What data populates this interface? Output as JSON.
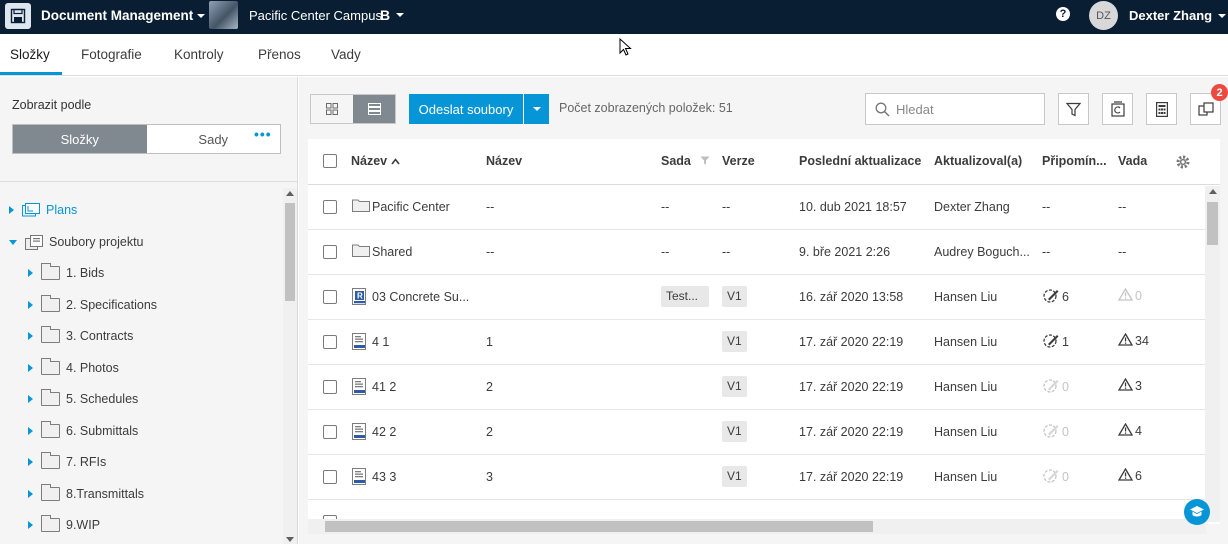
{
  "header": {
    "app_title": "Document Management",
    "project_name": "Pacific Center Campus",
    "project_badge": "B",
    "help": "?",
    "user_initials": "DZ",
    "user_name": "Dexter Zhang"
  },
  "tabs": [
    {
      "label": "Složky",
      "active": true
    },
    {
      "label": "Fotografie",
      "active": false
    },
    {
      "label": "Kontroly",
      "active": false
    },
    {
      "label": "Přenos",
      "active": false
    },
    {
      "label": "Vady",
      "active": false
    }
  ],
  "sidebar": {
    "view_by_label": "Zobrazit podle",
    "toggle": {
      "folders": "Složky",
      "sets": "Sady",
      "selected": "folders"
    },
    "more_label": "•••",
    "tree": [
      {
        "label": "Plans",
        "expanded": false,
        "highlight": true,
        "icon": "plans-icon"
      },
      {
        "label": "Soubory projektu",
        "expanded": true,
        "icon": "project-files-icon"
      },
      {
        "label": "1. Bids",
        "expanded": false,
        "icon": "folder-icon"
      },
      {
        "label": "2. Specifications",
        "expanded": false,
        "icon": "folder-icon"
      },
      {
        "label": "3. Contracts",
        "expanded": false,
        "icon": "folder-icon"
      },
      {
        "label": "4. Photos",
        "expanded": false,
        "icon": "folder-icon"
      },
      {
        "label": "5. Schedules",
        "expanded": false,
        "icon": "folder-icon"
      },
      {
        "label": "6. Submittals",
        "expanded": false,
        "icon": "folder-icon"
      },
      {
        "label": "7. RFIs",
        "expanded": false,
        "icon": "folder-icon"
      },
      {
        "label": "8.Transmittals",
        "expanded": false,
        "icon": "folder-icon"
      },
      {
        "label": "9.WIP",
        "expanded": false,
        "icon": "folder-icon"
      }
    ]
  },
  "toolbar": {
    "upload_label": "Odeslat soubory",
    "count_text": "Počet zobrazených položek: 51",
    "search_placeholder": "Hledat",
    "badge_count": "2"
  },
  "table": {
    "columns": {
      "name": "Název",
      "title": "Název",
      "set": "Sada",
      "version": "Verze",
      "last_updated": "Poslední aktualizace",
      "updated_by": "Aktualizoval(a)",
      "markups": "Připomín...",
      "issues": "Vada"
    },
    "rows": [
      {
        "type": "folder",
        "name": "Pacific Center",
        "title": "--",
        "set": "--",
        "version": "--",
        "updated": "10. dub 2021 18:57",
        "by": "Dexter Zhang",
        "markups": "--",
        "issues": "--"
      },
      {
        "type": "folder",
        "name": "Shared",
        "title": "--",
        "set": "--",
        "version": "--",
        "updated": "9. bře 2021 2:26",
        "by": "Audrey Boguch...",
        "markups": "--",
        "issues": "--"
      },
      {
        "type": "revit",
        "name": "03 Concrete Su...",
        "title": "",
        "set": "Test...",
        "version": "V1",
        "updated": "16. zář 2020 13:58",
        "by": "Hansen Liu",
        "markups": "6",
        "markups_active": true,
        "issues": "0",
        "issues_active": false
      },
      {
        "type": "sheet",
        "name": "4 1",
        "title": "1",
        "set": "",
        "version": "V1",
        "updated": "17. zář 2020 22:19",
        "by": "Hansen Liu",
        "markups": "1",
        "markups_active": true,
        "issues": "34",
        "issues_active": true
      },
      {
        "type": "sheet",
        "name": "41 2",
        "title": "2",
        "set": "",
        "version": "V1",
        "updated": "17. zář 2020 22:19",
        "by": "Hansen Liu",
        "markups": "0",
        "markups_active": false,
        "issues": "3",
        "issues_active": true
      },
      {
        "type": "sheet",
        "name": "42 2",
        "title": "2",
        "set": "",
        "version": "V1",
        "updated": "17. zář 2020 22:19",
        "by": "Hansen Liu",
        "markups": "0",
        "markups_active": false,
        "issues": "4",
        "issues_active": true
      },
      {
        "type": "sheet",
        "name": "43 3",
        "title": "3",
        "set": "",
        "version": "V1",
        "updated": "17. zář 2020 22:19",
        "by": "Hansen Liu",
        "markups": "0",
        "markups_active": false,
        "issues": "6",
        "issues_active": true
      }
    ]
  },
  "colors": {
    "header_bg": "#0a1e33",
    "accent": "#0696d7",
    "badge": "#ec4a41",
    "toggle_selected": "#808890"
  }
}
